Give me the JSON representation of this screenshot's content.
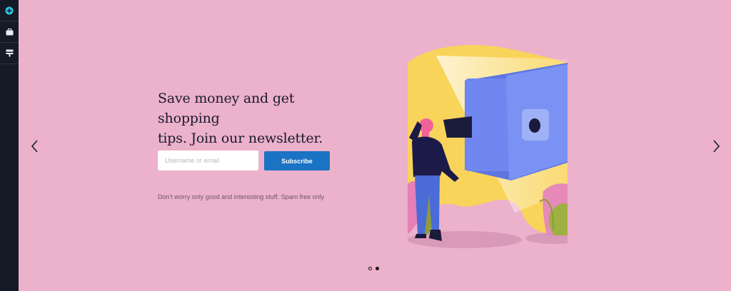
{
  "sidebar": {
    "items": [
      {
        "icon": "add-circle-icon"
      },
      {
        "icon": "briefcase-icon"
      },
      {
        "icon": "layout-icon"
      }
    ],
    "accent_color": "#33c3e0"
  },
  "carousel": {
    "prev_icon": "chevron-left-icon",
    "next_icon": "chevron-right-icon",
    "slide_count": 2,
    "active_slide": 2
  },
  "newsletter": {
    "headline": "Save money and get shopping\ntips.  Join our newsletter.",
    "input_placeholder": "Username or email",
    "subscribe_label": "Subscribe",
    "note": "Don't worry only good and interesting stuff. Spam free only"
  },
  "colors": {
    "background": "#ecb1cb",
    "button": "#1b73c3",
    "sidebar": "#141b27"
  }
}
